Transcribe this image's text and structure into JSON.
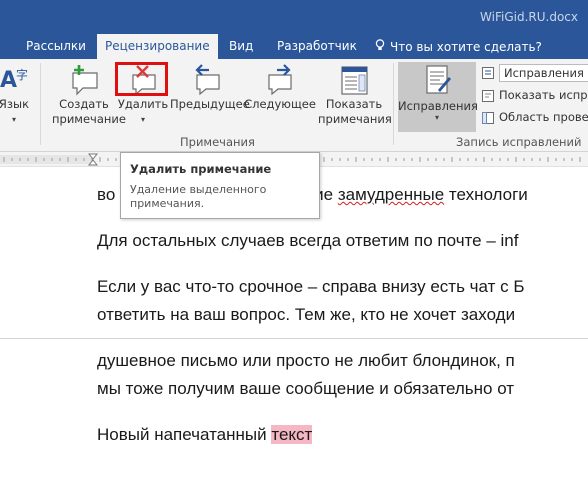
{
  "title_bar": {
    "watermark": "WiFiGid.RU.docx"
  },
  "tabs": [
    {
      "label": "Рассылки",
      "active": false
    },
    {
      "label": "Рецензирование",
      "active": true
    },
    {
      "label": "Вид",
      "active": false
    },
    {
      "label": "Разработчик",
      "active": false
    }
  ],
  "tell_me": {
    "label": "Что вы хотите сделать?"
  },
  "ribbon": {
    "language": {
      "label": "Язык"
    },
    "create_comment": {
      "line1": "Создать",
      "line2": "примечание"
    },
    "delete_comment": {
      "label": "Удалить"
    },
    "previous": {
      "label": "Предыдущее"
    },
    "next": {
      "label": "Следующее"
    },
    "show_comments": {
      "line1": "Показать",
      "line2": "примечания"
    },
    "comments_group_label": "Примечания",
    "track_changes": {
      "label": "Исправления"
    },
    "markup_select": {
      "value": "Исправления"
    },
    "show_markup": {
      "label": "Показать испра"
    },
    "reviewing_pane": {
      "label": "Область провер"
    },
    "tracking_group_label": "Запись исправлений"
  },
  "tooltip": {
    "title": "Удалить примечание",
    "description": "Удаление выделенного примечания."
  },
  "document": {
    "line1_start": "во",
    "line1_mid": "чие ",
    "line1_squiggle": "замудренные",
    "line1_end": " технологи",
    "line2": "Для остальных случаев всегда ответим по почте – inf",
    "line3": "Если у вас что-то срочное – справа внизу есть чат с Б",
    "line4": "ответить на ваш вопрос. Тем же, кто не хочет заходи",
    "line5": "душевное письмо или просто не любит блондинок, п",
    "line6": "мы тоже получим ваше сообщение и обязательно от",
    "line7_plain": "Новый напечатанный ",
    "line7_tracked": "текст"
  },
  "colors": {
    "title_blue": "#2b579a",
    "ribbon_bg": "#f3f3f3",
    "highlight_red": "#e01010",
    "tracked_pink": "#f4b7c3"
  },
  "icons": [
    "language-icon",
    "new-comment-icon",
    "delete-comment-icon",
    "previous-comment-icon",
    "next-comment-icon",
    "show-comments-icon",
    "track-changes-icon",
    "lightbulb-icon"
  ]
}
